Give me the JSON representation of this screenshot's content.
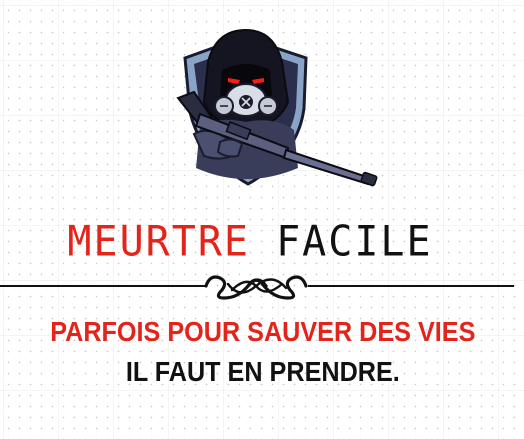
{
  "brand": {
    "word_one": "MEURTRE",
    "word_two": "FACILE"
  },
  "tagline": {
    "line_one": "PARFOIS POUR SAUVER DES VIES",
    "line_two": "IL FAUT EN PRENDRE."
  },
  "icons": {
    "mascot": "gas-mask-soldier-with-rifle-icon",
    "divider_ornament": "scroll-flourish-icon"
  },
  "colors": {
    "accent_red": "#e2241b",
    "text_black": "#111111",
    "shield_navy": "#2b2f4d",
    "shield_rim": "#8aa4c8",
    "eyes": "#ff1a1a"
  }
}
